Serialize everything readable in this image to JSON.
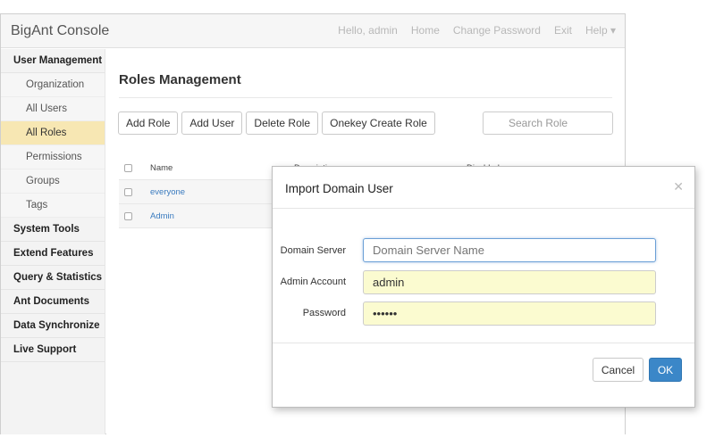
{
  "app": {
    "title": "BigAnt Console"
  },
  "nav": {
    "greeting": "Hello, admin",
    "home": "Home",
    "change_password": "Change Password",
    "exit": "Exit",
    "help": "Help ▾"
  },
  "sidebar": {
    "items": [
      {
        "label": "User Management",
        "kind": "head"
      },
      {
        "label": "Organization",
        "kind": "sub"
      },
      {
        "label": "All Users",
        "kind": "sub"
      },
      {
        "label": "All Roles",
        "kind": "sub",
        "active": true
      },
      {
        "label": "Permissions",
        "kind": "sub"
      },
      {
        "label": "Groups",
        "kind": "sub"
      },
      {
        "label": "Tags",
        "kind": "sub"
      },
      {
        "label": "System Tools",
        "kind": "head"
      },
      {
        "label": "Extend Features",
        "kind": "head"
      },
      {
        "label": "Query & Statistics",
        "kind": "head"
      },
      {
        "label": "Ant Documents",
        "kind": "head"
      },
      {
        "label": "Data Synchronize",
        "kind": "head"
      },
      {
        "label": "Live Support",
        "kind": "head"
      }
    ]
  },
  "main": {
    "title": "Roles Management",
    "toolbar": {
      "add_role": "Add Role",
      "add_user": "Add User",
      "delete_role": "Delete Role",
      "onekey_create_role": "Onekey Create Role"
    },
    "search": {
      "placeholder": "Search Role"
    },
    "table": {
      "columns": {
        "name": "Name",
        "description": "Description",
        "disabled": "Disabled"
      },
      "rows": [
        {
          "name": "everyone"
        },
        {
          "name": "Admin"
        }
      ]
    }
  },
  "modal": {
    "title": "Import Domain User",
    "fields": {
      "domain_server": {
        "label": "Domain Server",
        "placeholder": "Domain Server Name",
        "value": ""
      },
      "admin_account": {
        "label": "Admin Account",
        "value": "admin"
      },
      "password": {
        "label": "Password",
        "value": "••••••"
      }
    },
    "cancel": "Cancel",
    "ok": "OK"
  },
  "colors": {
    "accent": "#3b87c8",
    "active_nav": "#f7e7b3",
    "autofill": "#fbfbd0"
  }
}
